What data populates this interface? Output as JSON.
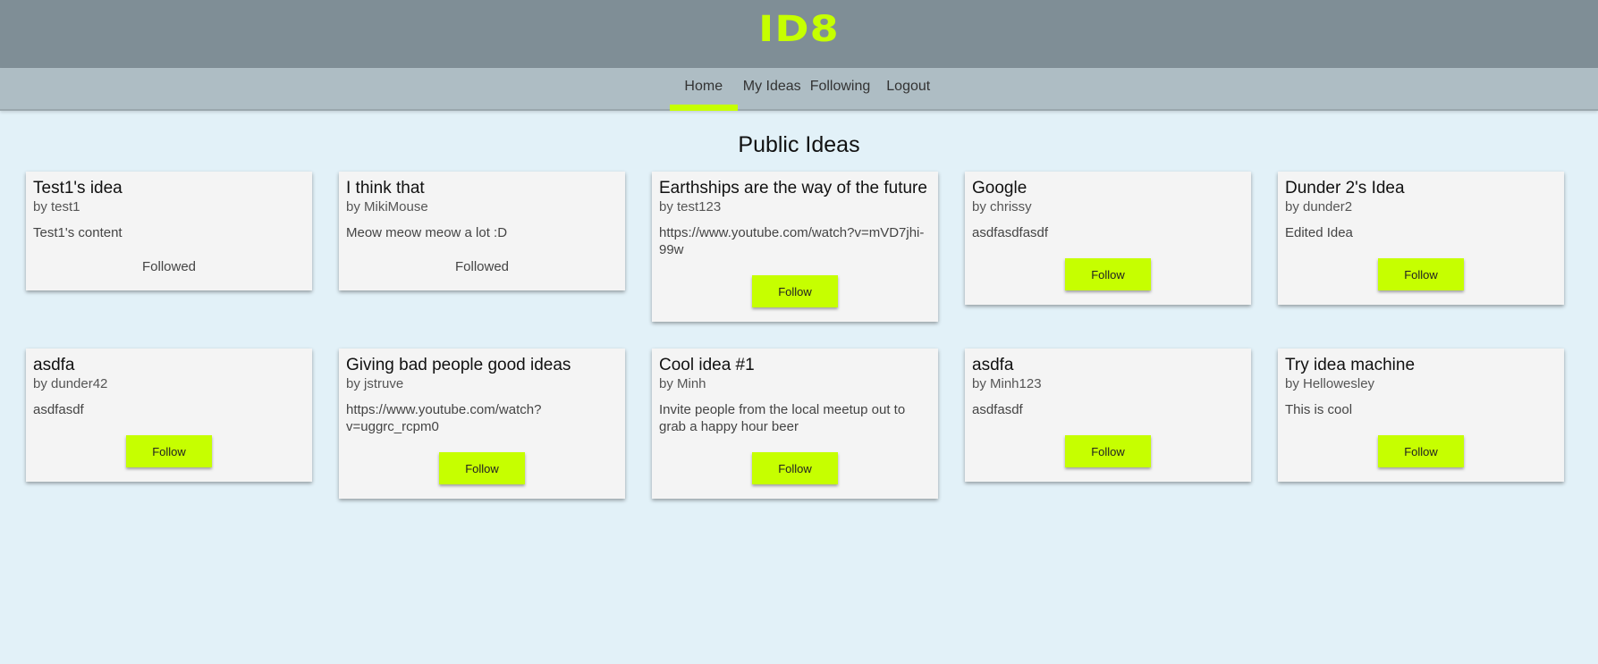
{
  "app": {
    "logo": "ID8"
  },
  "nav": {
    "items": [
      {
        "label": "Home",
        "active": true
      },
      {
        "label": "My Ideas",
        "active": false
      },
      {
        "label": "Following",
        "active": false
      },
      {
        "label": "Logout",
        "active": false
      }
    ]
  },
  "page": {
    "title": "Public Ideas"
  },
  "colors": {
    "accent": "#c6ff00",
    "header_bg": "#7f8e96",
    "nav_bg": "#aebdc4",
    "page_bg": "#e2f1f8",
    "card_bg": "#f4f4f4"
  },
  "ideas": [
    {
      "title": "Test1's idea",
      "author": "by test1",
      "content": "Test1's content",
      "status": "Followed"
    },
    {
      "title": "I think that",
      "author": "by MikiMouse",
      "content": "Meow meow meow a lot :D",
      "status": "Followed"
    },
    {
      "title": "Earthships are the way of the future",
      "author": "by test123",
      "content": "https://www.youtube.com/watch?v=mVD7jhi-99w",
      "status": "Follow"
    },
    {
      "title": "Google",
      "author": "by chrissy",
      "content": "asdfasdfasdf",
      "status": "Follow"
    },
    {
      "title": "Dunder 2's Idea",
      "author": "by dunder2",
      "content": "Edited Idea",
      "status": "Follow"
    },
    {
      "title": "asdfa",
      "author": "by dunder42",
      "content": "asdfasdf",
      "status": "Follow"
    },
    {
      "title": "Giving bad people good ideas",
      "author": "by jstruve",
      "content": "https://www.youtube.com/watch?v=uggrc_rcpm0",
      "status": "Follow"
    },
    {
      "title": "Cool idea #1",
      "author": "by Minh",
      "content": "Invite people from the local meetup out to grab a happy hour beer",
      "status": "Follow"
    },
    {
      "title": "asdfa",
      "author": "by Minh123",
      "content": "asdfasdf",
      "status": "Follow"
    },
    {
      "title": "Try idea machine",
      "author": "by Hellowesley",
      "content": "This is cool",
      "status": "Follow"
    }
  ]
}
